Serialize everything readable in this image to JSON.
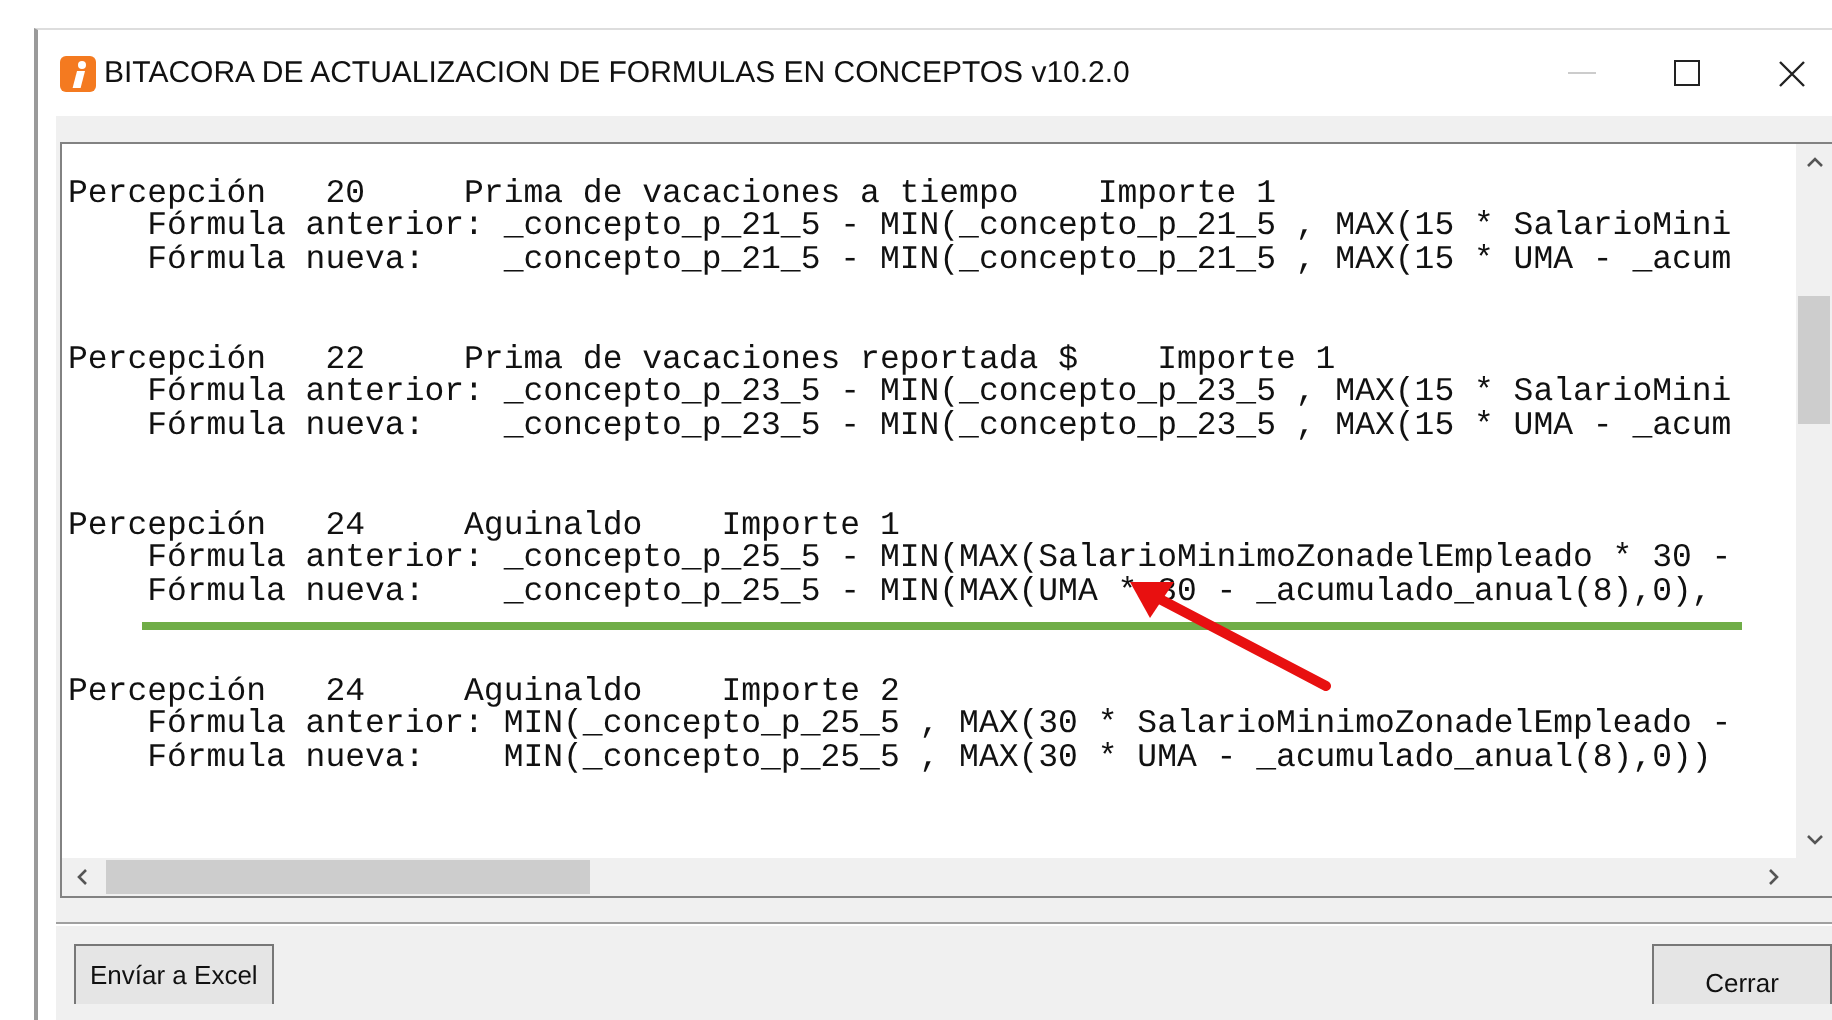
{
  "window": {
    "title": "BITACORA DE ACTUALIZACION DE FORMULAS EN CONCEPTOS v10.2.0"
  },
  "entries": [
    {
      "type": "Percepción",
      "number": "20",
      "concept": "Prima de vacaciones a tiempo",
      "amount": "Importe 1",
      "previous_label": "Fórmula anterior:",
      "previous": "_concepto_p_21_5 - MIN(_concepto_p_21_5 , MAX(15 * SalarioMini",
      "new_label": "Fórmula nueva:",
      "new": "_concepto_p_21_5 - MIN(_concepto_p_21_5 , MAX(15 * UMA - _acum",
      "underlined": false
    },
    {
      "type": "Percepción",
      "number": "22",
      "concept": "Prima de vacaciones reportada $",
      "amount": "Importe 1",
      "previous_label": "Fórmula anterior:",
      "previous": "_concepto_p_23_5 - MIN(_concepto_p_23_5 , MAX(15 * SalarioMini",
      "new_label": "Fórmula nueva:",
      "new": "_concepto_p_23_5 - MIN(_concepto_p_23_5 , MAX(15 * UMA - _acum",
      "underlined": false
    },
    {
      "type": "Percepción",
      "number": "24",
      "concept": "Aguinaldo",
      "amount": "Importe 1",
      "previous_label": "Fórmula anterior:",
      "previous": "_concepto_p_25_5 - MIN(MAX(SalarioMinimoZonadelEmpleado * 30 -",
      "new_label": "Fórmula nueva:",
      "new": "_concepto_p_25_5 - MIN(MAX(UMA * 30 - _acumulado_anual(8),0),",
      "underlined": true
    },
    {
      "type": "Percepción",
      "number": "24",
      "concept": "Aguinaldo",
      "amount": "Importe 2",
      "previous_label": "Fórmula anterior:",
      "previous": "MIN(_concepto_p_25_5 , MAX(30 * SalarioMinimoZonadelEmpleado -",
      "new_label": "Fórmula nueva:",
      "new": "MIN(_concepto_p_25_5 , MAX(30 * UMA - _acumulado_anual(8),0))",
      "underlined": false
    }
  ],
  "buttons": [
    {
      "label": "Envíar a Excel"
    },
    {
      "label": "Cerrar"
    }
  ]
}
